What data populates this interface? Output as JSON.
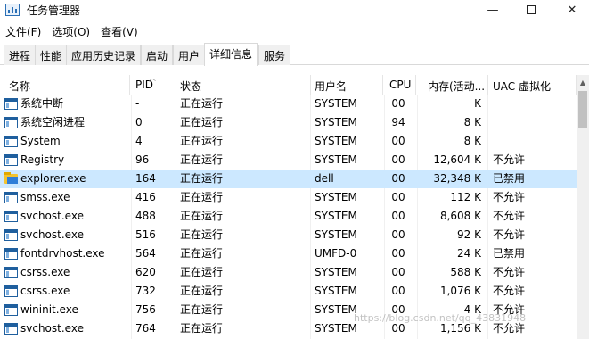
{
  "window": {
    "title": "任务管理器",
    "minimize": "—",
    "close": "✕"
  },
  "menu": [
    "文件(F)",
    "选项(O)",
    "查看(V)"
  ],
  "tabs": [
    "进程",
    "性能",
    "应用历史记录",
    "启动",
    "用户",
    "详细信息",
    "服务"
  ],
  "active_tab": "详细信息",
  "columns": {
    "name": "名称",
    "pid": "PID",
    "status": "状态",
    "user": "用户名",
    "cpu": "CPU",
    "memory": "内存(活动...",
    "uac": "UAC 虚拟化"
  },
  "rows": [
    {
      "name": "系统中断",
      "pid": "-",
      "status": "正在运行",
      "user": "SYSTEM",
      "cpu": "00",
      "memory": "K",
      "uac": "",
      "icon": "app-window-icon"
    },
    {
      "name": "系统空闲进程",
      "pid": "0",
      "status": "正在运行",
      "user": "SYSTEM",
      "cpu": "94",
      "memory": "8 K",
      "uac": "",
      "icon": "app-window-icon"
    },
    {
      "name": "System",
      "pid": "4",
      "status": "正在运行",
      "user": "SYSTEM",
      "cpu": "00",
      "memory": "8 K",
      "uac": "",
      "icon": "app-window-icon"
    },
    {
      "name": "Registry",
      "pid": "96",
      "status": "正在运行",
      "user": "SYSTEM",
      "cpu": "00",
      "memory": "12,604 K",
      "uac": "不允许",
      "icon": "app-window-icon"
    },
    {
      "name": "explorer.exe",
      "pid": "164",
      "status": "正在运行",
      "user": "dell",
      "cpu": "00",
      "memory": "32,348 K",
      "uac": "已禁用",
      "icon": "folder-icon",
      "highlight": true
    },
    {
      "name": "smss.exe",
      "pid": "416",
      "status": "正在运行",
      "user": "SYSTEM",
      "cpu": "00",
      "memory": "112 K",
      "uac": "不允许",
      "icon": "app-window-icon"
    },
    {
      "name": "svchost.exe",
      "pid": "488",
      "status": "正在运行",
      "user": "SYSTEM",
      "cpu": "00",
      "memory": "8,608 K",
      "uac": "不允许",
      "icon": "app-window-icon"
    },
    {
      "name": "svchost.exe",
      "pid": "516",
      "status": "正在运行",
      "user": "SYSTEM",
      "cpu": "00",
      "memory": "92 K",
      "uac": "不允许",
      "icon": "app-window-icon"
    },
    {
      "name": "fontdrvhost.exe",
      "pid": "564",
      "status": "正在运行",
      "user": "UMFD-0",
      "cpu": "00",
      "memory": "24 K",
      "uac": "已禁用",
      "icon": "app-window-icon"
    },
    {
      "name": "csrss.exe",
      "pid": "620",
      "status": "正在运行",
      "user": "SYSTEM",
      "cpu": "00",
      "memory": "588 K",
      "uac": "不允许",
      "icon": "app-window-icon"
    },
    {
      "name": "csrss.exe",
      "pid": "732",
      "status": "正在运行",
      "user": "SYSTEM",
      "cpu": "00",
      "memory": "1,076 K",
      "uac": "不允许",
      "icon": "app-window-icon"
    },
    {
      "name": "wininit.exe",
      "pid": "756",
      "status": "正在运行",
      "user": "SYSTEM",
      "cpu": "00",
      "memory": "4 K",
      "uac": "不允许",
      "icon": "app-window-icon"
    },
    {
      "name": "svchost.exe",
      "pid": "764",
      "status": "正在运行",
      "user": "SYSTEM",
      "cpu": "00",
      "memory": "1,156 K",
      "uac": "不允许",
      "icon": "app-window-icon"
    }
  ],
  "watermark": "https://blog.csdn.net/qq_43831948"
}
